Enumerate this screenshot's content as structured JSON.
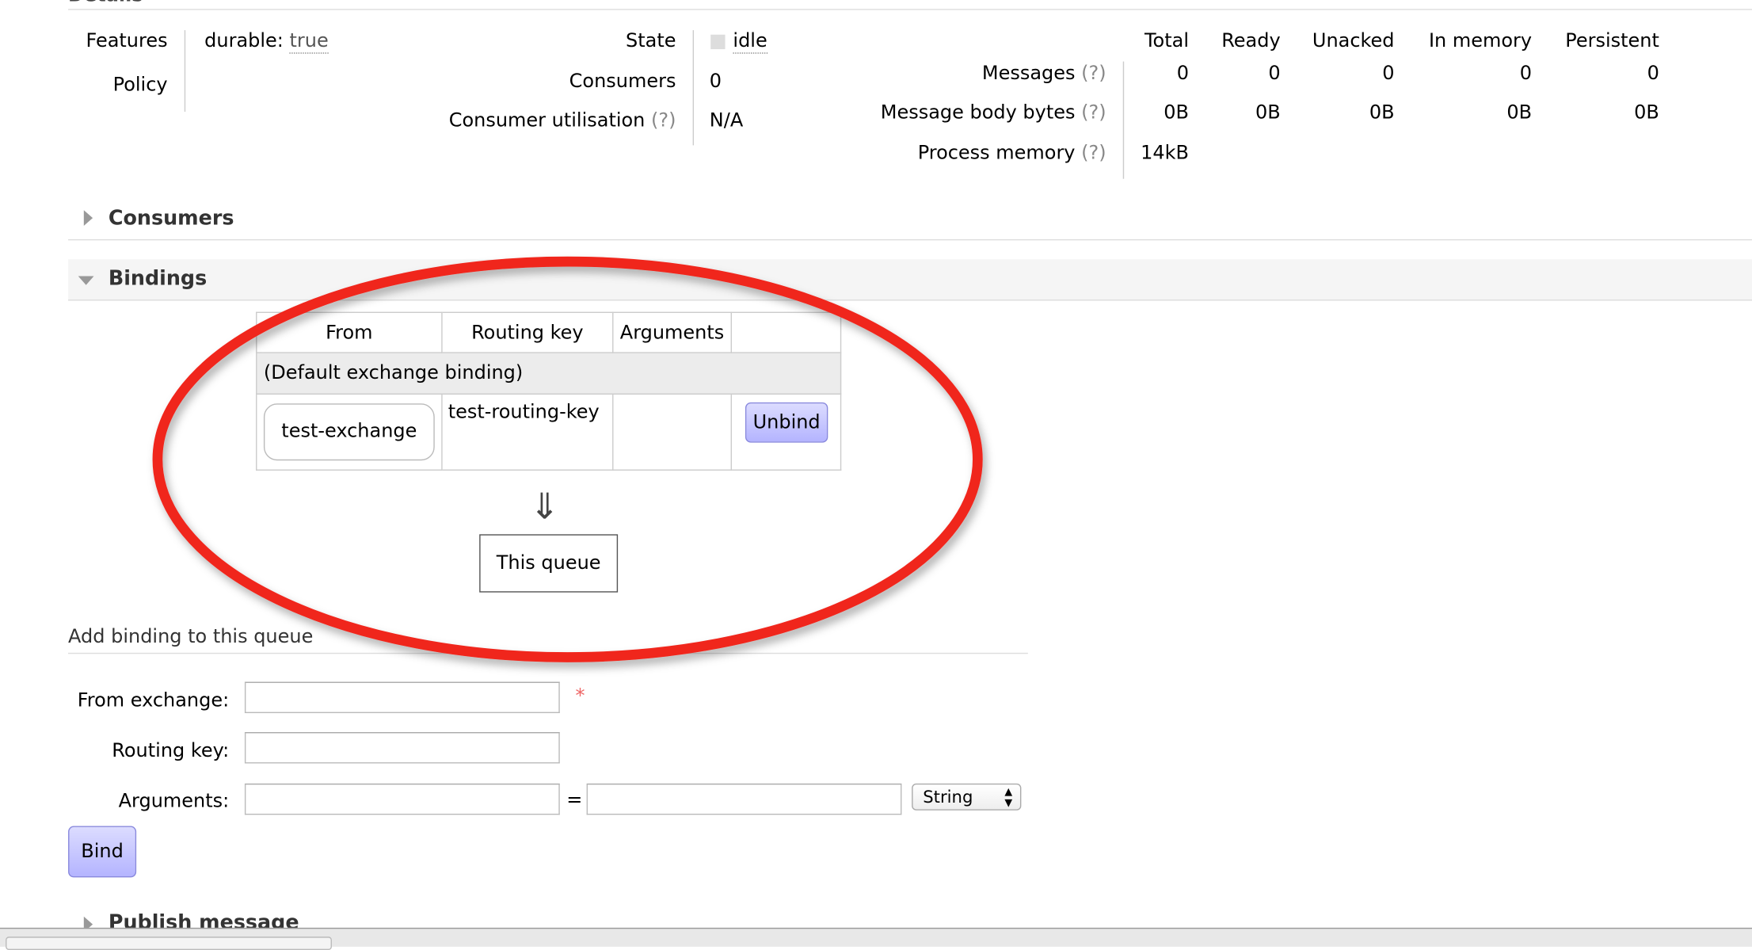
{
  "details": {
    "title": "Details",
    "features_label": "Features",
    "features_key": "durable:",
    "features_value": "true",
    "policy_label": "Policy",
    "state_label": "State",
    "state_value": "idle",
    "consumers_label": "Consumers",
    "consumers_value": "0",
    "utilisation_label": "Consumer utilisation",
    "utilisation_value": "N/A",
    "help": "(?)"
  },
  "stats": {
    "columns": [
      "Total",
      "Ready",
      "Unacked",
      "In memory",
      "Persistent"
    ],
    "rows": [
      {
        "label": "Messages",
        "values": [
          "0",
          "0",
          "0",
          "0",
          "0"
        ]
      },
      {
        "label": "Message body bytes",
        "values": [
          "0B",
          "0B",
          "0B",
          "0B",
          "0B"
        ]
      },
      {
        "label": "Process memory",
        "values": [
          "14kB"
        ]
      }
    ]
  },
  "sections": {
    "consumers": "Consumers",
    "bindings": "Bindings",
    "publish": "Publish message"
  },
  "bindings": {
    "headers": [
      "From",
      "Routing key",
      "Arguments"
    ],
    "default_row": "(Default exchange binding)",
    "row": {
      "from": "test-exchange",
      "routing_key": "test-routing-key",
      "arguments": "",
      "action": "Unbind"
    },
    "arrow": "⇓",
    "this_queue": "This queue"
  },
  "add_binding": {
    "title": "Add binding to this queue",
    "from_label": "From exchange:",
    "from_value": "",
    "required": "*",
    "routing_label": "Routing key:",
    "routing_value": "",
    "args_label": "Arguments:",
    "args_key": "",
    "equals": "=",
    "args_value": "",
    "type_select": "String",
    "submit": "Bind"
  },
  "colors": {
    "annotation": "#f0261d",
    "button": "#c8c8ff"
  }
}
